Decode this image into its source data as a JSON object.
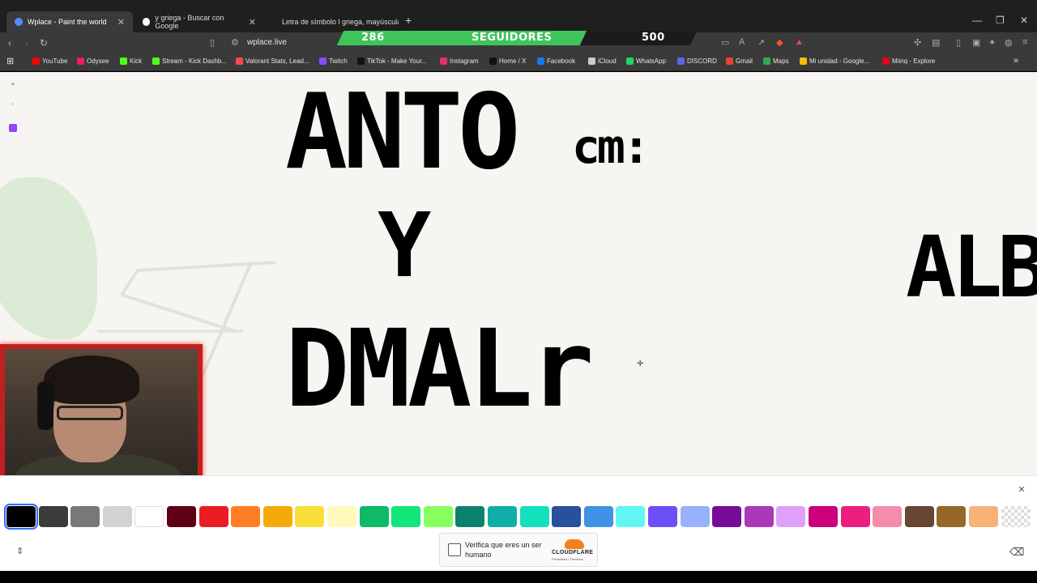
{
  "tabs": [
    {
      "label": "Wplace - Paint the world",
      "active": true
    },
    {
      "label": "y griega - Buscar con Google",
      "active": false
    },
    {
      "label": "Letra de símbolo l griega, mayúscula",
      "active": false
    }
  ],
  "address": {
    "url": "wplace.live"
  },
  "overlay": {
    "count_left": "286",
    "label": "SEGUIDORES",
    "count_right": "500"
  },
  "bookmarks": [
    {
      "label": "YouTube",
      "color": "#ff0000"
    },
    {
      "label": "Odysee",
      "color": "#ef1970"
    },
    {
      "label": "Kick",
      "color": "#53fc18"
    },
    {
      "label": "Stream - Kick Dashb...",
      "color": "#53fc18"
    },
    {
      "label": "Valorant Stats, Lead...",
      "color": "#ff4655"
    },
    {
      "label": "Twitch",
      "color": "#9146ff"
    },
    {
      "label": "TikTok - Make Your...",
      "color": "#111111"
    },
    {
      "label": "Instagram",
      "color": "#e1306c"
    },
    {
      "label": "Home / X",
      "color": "#111111"
    },
    {
      "label": "Facebook",
      "color": "#1877f2"
    },
    {
      "label": "iCloud",
      "color": "#cccccc"
    },
    {
      "label": "WhatsApp",
      "color": "#25d366"
    },
    {
      "label": "DISCORD",
      "color": "#5865f2"
    },
    {
      "label": "Gmail",
      "color": "#ea4335"
    },
    {
      "label": "Maps",
      "color": "#34a853"
    },
    {
      "label": "Mi unidad - Google...",
      "color": "#fbbc04"
    },
    {
      "label": "Miinq - Explore",
      "color": "#e60023"
    }
  ],
  "canvas_art": {
    "line1_big": "ANTO",
    "line1_small": "cm:",
    "line2": "Y",
    "line3": "DMALr",
    "right_edge": "ALB"
  },
  "palette": {
    "colors": [
      "#000000",
      "#3c3c3c",
      "#787878",
      "#d2d2d2",
      "#ffffff",
      "#600018",
      "#ed1c24",
      "#ff7f27",
      "#f6aa09",
      "#f9dd3b",
      "#fffabc",
      "#0eb968",
      "#13e67b",
      "#87ff5e",
      "#0c816e",
      "#10aea6",
      "#13e1be",
      "#28509e",
      "#4093e4",
      "#60f7f2",
      "#6b50f6",
      "#99b1fb",
      "#780c99",
      "#aa38b9",
      "#e09ff9",
      "#cb007a",
      "#ec1f80",
      "#f38da9",
      "#684634",
      "#95682a",
      "#f8b277",
      "transparent"
    ],
    "selected_index": 0
  },
  "captcha": {
    "label": "Verifica que eres un ser humano",
    "brand": "CLOUDFLARE",
    "links": "Privacidad • Términos"
  }
}
